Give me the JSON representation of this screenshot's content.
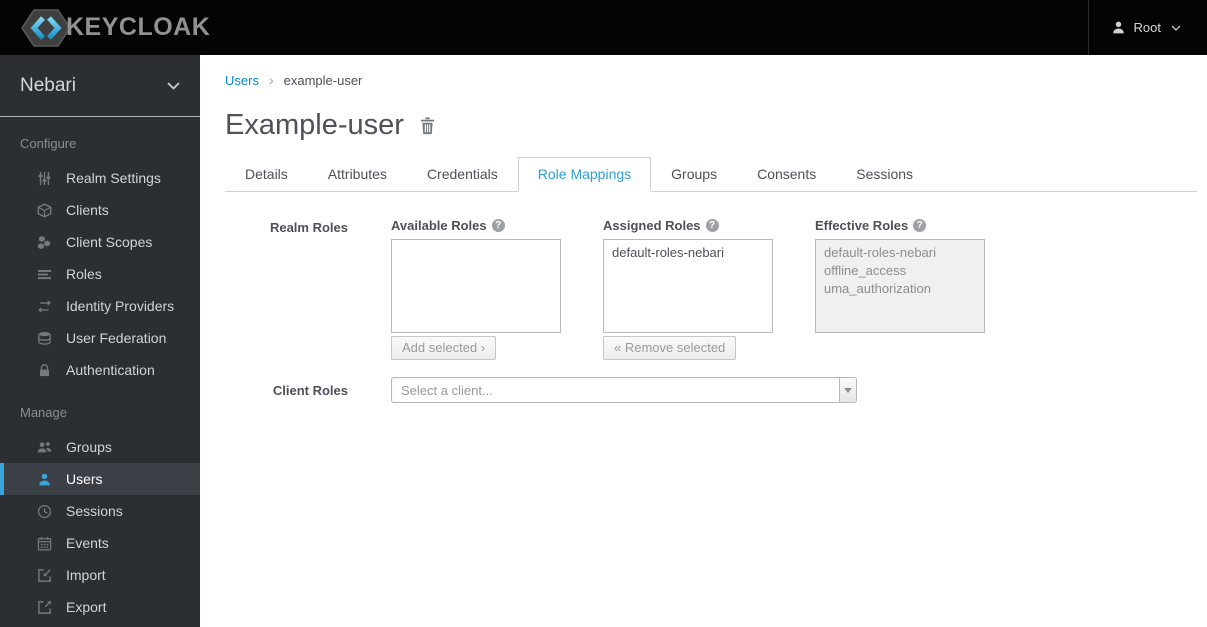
{
  "colors": {
    "navbar_bg": "#040404",
    "sidebar_bg": "#2b2e33",
    "active_item_bg": "#3b4046",
    "accent_blue": "#39a5dc",
    "link_blue": "#0088ce",
    "active_tab_blue": "#2d9fd8",
    "text_dark": "#4d5258"
  },
  "navbar": {
    "brand": "KEYCLOAK",
    "user_label": "Root"
  },
  "sidebar": {
    "realm_name": "Nebari",
    "sections": [
      {
        "label": "Configure",
        "items": [
          {
            "label": "Realm Settings",
            "icon": "sliders-icon"
          },
          {
            "label": "Clients",
            "icon": "cube-icon"
          },
          {
            "label": "Client Scopes",
            "icon": "cubes-icon"
          },
          {
            "label": "Roles",
            "icon": "list-icon"
          },
          {
            "label": "Identity Providers",
            "icon": "exchange-icon"
          },
          {
            "label": "User Federation",
            "icon": "database-icon"
          },
          {
            "label": "Authentication",
            "icon": "lock-icon"
          }
        ]
      },
      {
        "label": "Manage",
        "items": [
          {
            "label": "Groups",
            "icon": "users-icon"
          },
          {
            "label": "Users",
            "icon": "user-icon",
            "active": true
          },
          {
            "label": "Sessions",
            "icon": "clock-icon"
          },
          {
            "label": "Events",
            "icon": "calendar-icon"
          },
          {
            "label": "Import",
            "icon": "import-icon"
          },
          {
            "label": "Export",
            "icon": "export-icon"
          }
        ]
      }
    ]
  },
  "breadcrumb": {
    "parent": "Users",
    "separator": "›",
    "current": "example-user"
  },
  "page": {
    "title": "Example-user"
  },
  "tabs": {
    "items": [
      "Details",
      "Attributes",
      "Credentials",
      "Role Mappings",
      "Groups",
      "Consents",
      "Sessions"
    ],
    "active": "Role Mappings"
  },
  "form": {
    "realm_roles": {
      "label": "Realm Roles",
      "available": {
        "label": "Available Roles",
        "items": [],
        "button_label": "Add selected ›"
      },
      "assigned": {
        "label": "Assigned Roles",
        "items": [
          "default-roles-nebari"
        ],
        "button_label": "« Remove selected"
      },
      "effective": {
        "label": "Effective Roles",
        "items": [
          "default-roles-nebari",
          "offline_access",
          "uma_authorization"
        ]
      }
    },
    "client_roles": {
      "label": "Client Roles",
      "placeholder": "Select a client..."
    }
  }
}
